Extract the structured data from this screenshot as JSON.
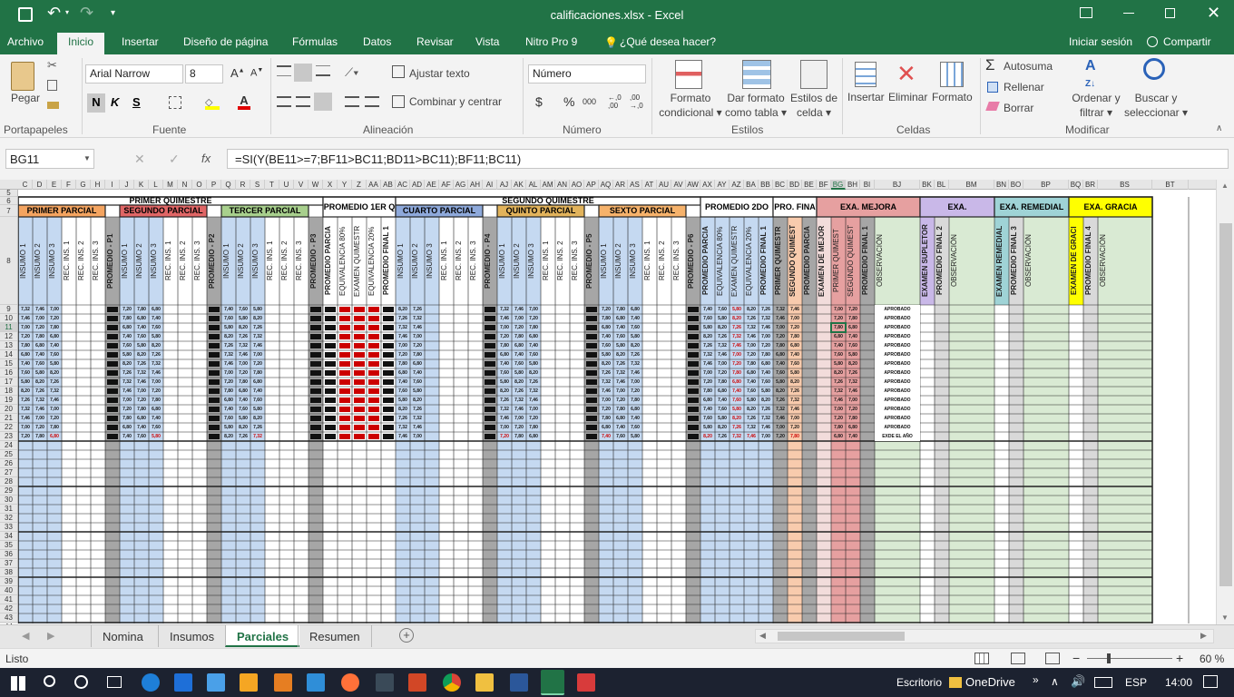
{
  "titlebar": {
    "filename": "calificaciones.xlsx - Excel"
  },
  "menu_tabs": [
    {
      "label": "Archivo"
    },
    {
      "label": "Inicio"
    },
    {
      "label": "Insertar"
    },
    {
      "label": "Diseño de página"
    },
    {
      "label": "Fórmulas"
    },
    {
      "label": "Datos"
    },
    {
      "label": "Revisar"
    },
    {
      "label": "Vista"
    },
    {
      "label": "Nitro Pro 9"
    },
    {
      "label": "¿Qué desea hacer?"
    }
  ],
  "account": {
    "signin": "Iniciar sesión",
    "share": "Compartir"
  },
  "ribbon": {
    "paste": "Pegar",
    "font_name": "Arial Narrow",
    "font_size": "8",
    "bold": "N",
    "italic": "K",
    "underline": "S",
    "wrap_text": "Ajustar texto",
    "merge_center": "Combinar y centrar",
    "number_format": "Número",
    "currency": "$",
    "percent": "%",
    "thousands": "000",
    "dec_inc": ",0\n,00",
    "dec_dec": ",00\n,0",
    "cond_format": "Formato\ncondicional",
    "format_table": "Dar formato\ncomo tabla",
    "cell_styles": "Estilos de\ncelda",
    "insert": "Insertar",
    "delete": "Eliminar",
    "format": "Formato",
    "autosum": "Autosuma",
    "fill": "Rellenar",
    "clear": "Borrar",
    "sort_filter": "Ordenar y\nfiltrar",
    "find_select": "Buscar y\nseleccionar",
    "groups": [
      "Portapapeles",
      "Fuente",
      "Alineación",
      "Número",
      "Estilos",
      "Celdas",
      "Modificar"
    ]
  },
  "formula_bar": {
    "name_box": "BG11",
    "fx": "fx",
    "formula": "=SI(Y(BE11>=7;BF11>BC11;BD11>BC11);BF11;BC11)"
  },
  "columns": [
    "C",
    "D",
    "E",
    "F",
    "G",
    "H",
    "I",
    "J",
    "K",
    "L",
    "M",
    "N",
    "O",
    "P",
    "Q",
    "R",
    "S",
    "T",
    "U",
    "V",
    "W",
    "X",
    "Y",
    "Z",
    "AA",
    "AB",
    "AC",
    "AD",
    "AE",
    "AF",
    "AG",
    "AH",
    "AI",
    "AJ",
    "AK",
    "AL",
    "AM",
    "AN",
    "AO",
    "AP",
    "AQ",
    "AR",
    "AS",
    "AT",
    "AU",
    "AV",
    "AW",
    "AX",
    "AY",
    "AZ",
    "BA",
    "BB",
    "BC",
    "BD",
    "BE",
    "BF",
    "BG",
    "BH",
    "BI",
    "BJ",
    "BK",
    "BL",
    "BM",
    "BN",
    "BO",
    "BP",
    "BQ",
    "BR",
    "BS",
    "BT"
  ],
  "rows": [
    "5",
    "6",
    "7",
    "8",
    "9",
    "10",
    "11",
    "12",
    "13",
    "14",
    "15",
    "16",
    "17",
    "18",
    "19",
    "20",
    "21",
    "22",
    "23",
    "24",
    "25",
    "26",
    "27",
    "28",
    "29",
    "30",
    "31",
    "32",
    "33",
    "34",
    "35",
    "36",
    "37",
    "38",
    "39",
    "40",
    "41",
    "42",
    "43",
    "44"
  ],
  "sheet": {
    "headers": {
      "primer_quimestre": "PRIMER QUIMESTRE",
      "promedio_1er": "PROMEDIO 1ER Q",
      "segundo_quimestre": "SEGUNDO QUIMESTRE",
      "promedio_2do": "PROMEDIO 2DO",
      "pro_final": "PRO. FINA",
      "exa_mejora": "EXA. MEJORA",
      "exa": "EXA.",
      "exa_remedial": "EXA. REMEDIAL",
      "exa_gracia": "EXA. GRACIA",
      "primer_parcial": "PRIMER PARCIAL",
      "segundo_parcial": "SEGUNDO PARCIAL",
      "tercer_parcial": "TERCER PARCIAL",
      "cuarto_parcial": "CUARTO PARCIAL",
      "quinto_parcial": "QUINTO PARCIAL",
      "sexto_parcial": "SEXTO PARCIAL"
    },
    "vertical_labels": [
      "INSUMO 1",
      "INSUMO 2",
      "INSUMO 3",
      "REC. INS. 1",
      "REC. INS. 2",
      "REC. INS. 3",
      "PROMEDIO - P1",
      "PROMEDIO - P2",
      "PROMEDIO - P3",
      "PROMEDIO - P4",
      "PROMEDIO - P5",
      "PROMEDIO - P6",
      "PROMEDIO PARCIA",
      "EQUIVALENCIA 80%",
      "EXAMEN QUIMESTR",
      "EQUIVALENCIA 20%",
      "PROMEDIO FINAL 1",
      "PRIMER QUIMESTR",
      "SEGUNDO QUIMEST",
      "PROMEDIO PARCIA",
      "EXAMEN DE MEJOR",
      "PRIMER QUIMEST",
      "SEGUNDO QUIMEST",
      "PROMEDIO FINAL 1",
      "OBSERVACIÓN",
      "EXAMEN SUPLETOR",
      "PROMEDIO FINAL 2",
      "OBSERVACIÓN",
      "EXAMEN REMEDIAL",
      "PROMEDIO FINAL 3",
      "OBSERVACIÓN",
      "EXAMEN DE GRACI",
      "PROMEDIO FINAL 4",
      "OBSERVACIÓN"
    ],
    "observations": [
      "APROBADO",
      "APROBADO",
      "APROBADO",
      "APROBADO",
      "APROBADO",
      "APROBADO",
      "APROBADO",
      "APROBADO",
      "APROBADO",
      "APROBADO",
      "APROBADO",
      "APROBADO",
      "APROBADO",
      "APROBADO",
      "EXDE EL AÑO"
    ],
    "sample_values": [
      "7,00",
      "7,20",
      "7,80",
      "6,80",
      "7,40",
      "7,60",
      "5,80",
      "8,20",
      "7,26",
      "7,32",
      "7,46"
    ]
  },
  "sheet_tabs": [
    {
      "label": "Nomina"
    },
    {
      "label": "Insumos"
    },
    {
      "label": "Parciales"
    },
    {
      "label": "Resumen"
    }
  ],
  "status": {
    "ready": "Listo",
    "zoom": "60 %"
  },
  "taskbar": {
    "desktop": "Escritorio",
    "onedrive": "OneDrive",
    "lang": "ESP",
    "time": "14:00"
  },
  "colors": {
    "excel_green": "#217346",
    "orange": "#f4a460",
    "pink": "#e6a0a0",
    "green": "#a8d08d",
    "blue": "#8ea9db",
    "yellow": "#ffff00",
    "lavender": "#c9b8e8",
    "teal": "#9fd3d6",
    "light_blue": "#c5d9f1",
    "light_green": "#d9ead3"
  }
}
